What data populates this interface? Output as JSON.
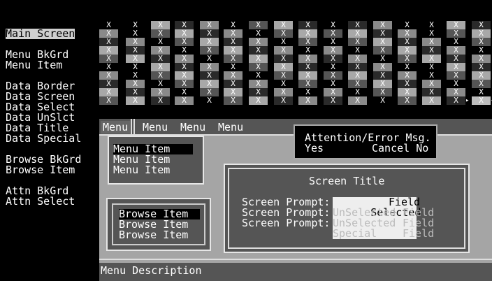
{
  "left_list": {
    "items": [
      {
        "label": "Main Screen",
        "selected": true
      },
      {
        "label": "Menu BkGrd"
      },
      {
        "label": "Menu Item"
      },
      {
        "label": "Data Border"
      },
      {
        "label": "Data Screen"
      },
      {
        "label": "Data Select"
      },
      {
        "label": "Data UnSlct"
      },
      {
        "label": "Data Title"
      },
      {
        "label": "Data Special"
      },
      {
        "label": "Browse BkGrd"
      },
      {
        "label": "Browse Item"
      },
      {
        "label": "Attn BkGrd"
      },
      {
        "label": "Attn Select"
      }
    ]
  },
  "palette": {
    "cell_char": "X",
    "colors": {
      "black": "#000000",
      "dark": "#2a2a2a",
      "mid": "#555555",
      "light": "#8a8a8a",
      "lighter": "#a8a8a8"
    }
  },
  "preview": {
    "menu_bar": {
      "items": [
        "Menu",
        "Menu",
        "Menu",
        "Menu"
      ]
    },
    "dropdown": {
      "items": [
        "Menu Item",
        "Menu Item",
        "Menu Item"
      ]
    },
    "attention": {
      "title": "Attention/Error Msg.",
      "yes": "Yes",
      "cancel_no": "Cancel No"
    },
    "browse": {
      "items": [
        "Browse Item",
        "Browse Item",
        "Browse Item"
      ]
    },
    "data_screen": {
      "title": "Screen Title",
      "rows": [
        {
          "prompt": "Screen Prompt:",
          "value": "Selected",
          "field": "Field"
        },
        {
          "prompt": "Screen Prompt:",
          "value": "UnSelected",
          "field": "Field"
        },
        {
          "prompt": "Screen Prompt:",
          "value": "UnSelected",
          "field": "Field"
        },
        {
          "prompt": "",
          "value": "Special",
          "field": "Field"
        }
      ]
    },
    "status": "Menu Description"
  }
}
